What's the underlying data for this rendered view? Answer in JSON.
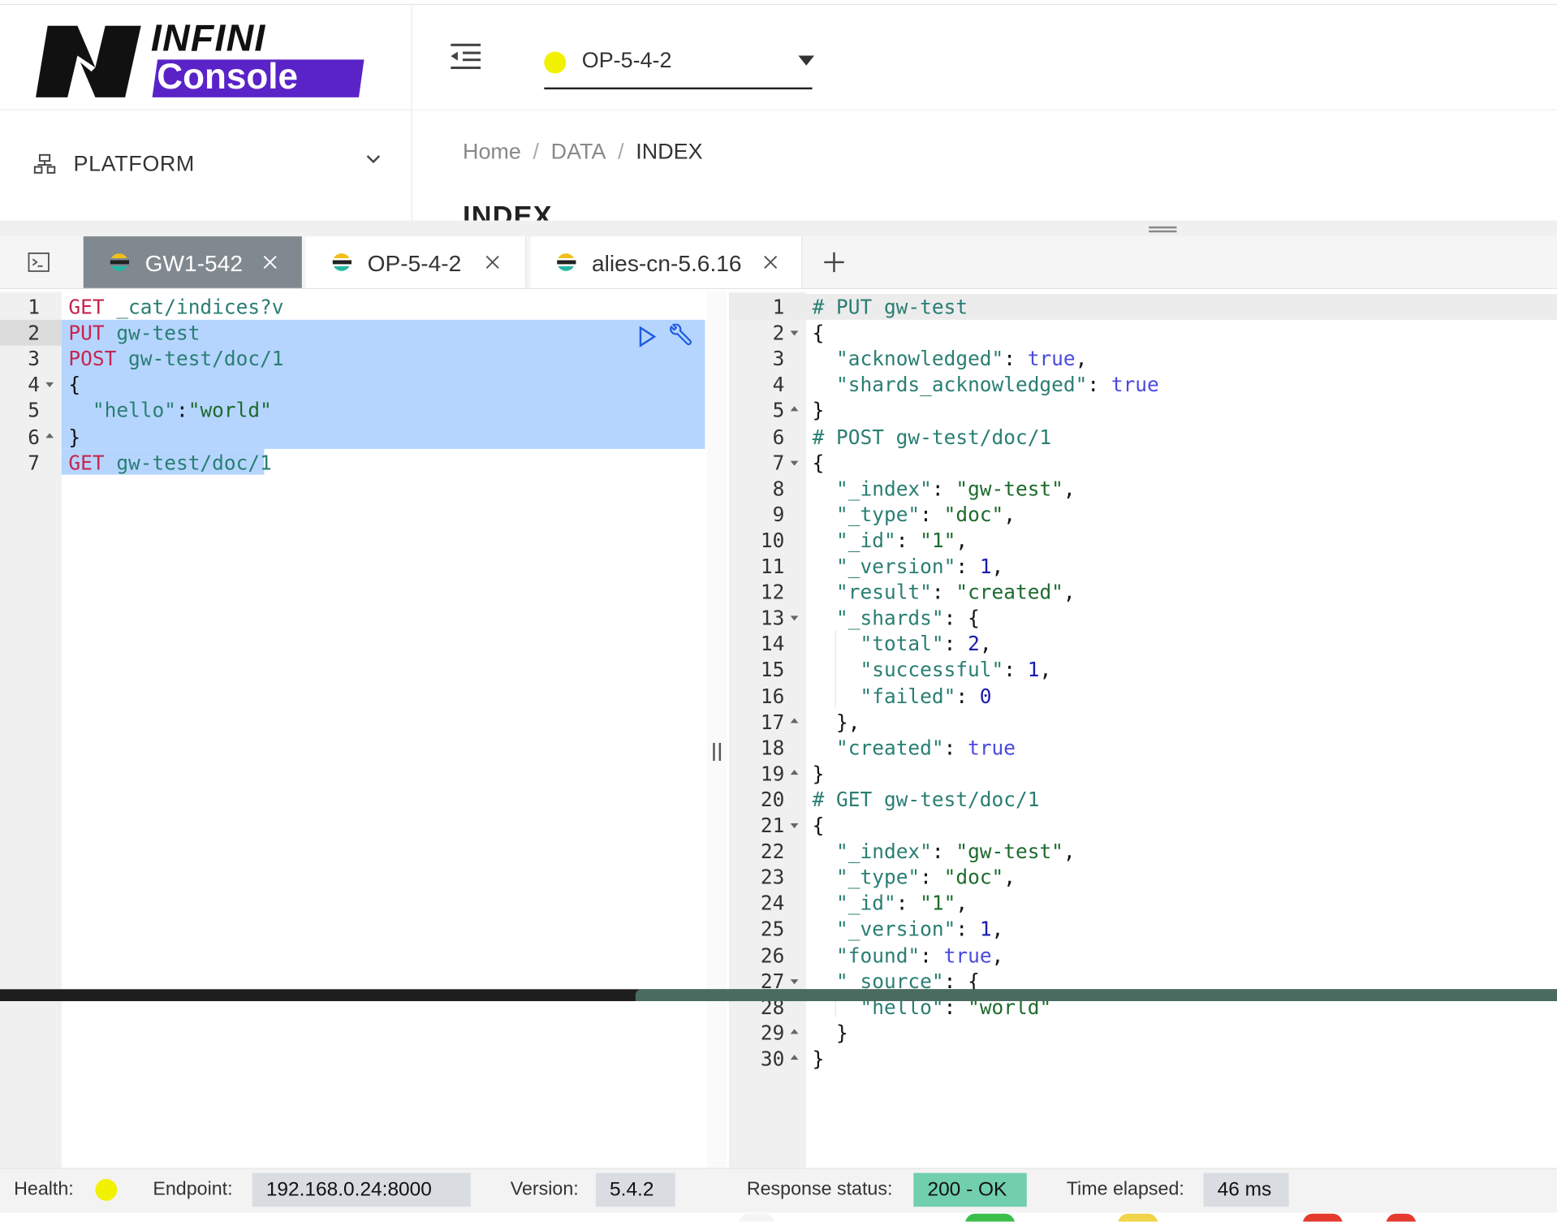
{
  "brand": {
    "line1": "INFINI",
    "line2": "Console",
    "slashes": "///"
  },
  "header": {
    "cluster": "OP-5-4-2",
    "cluster_status_color": "#f2f200"
  },
  "sidebar": {
    "platform_label": "PLATFORM"
  },
  "breadcrumb": {
    "items": [
      "Home",
      "DATA",
      "INDEX"
    ],
    "separator": "/"
  },
  "page": {
    "heading": "INDEX"
  },
  "tabs": [
    {
      "label": "GW1-542",
      "active": true
    },
    {
      "label": "OP-5-4-2",
      "active": false
    },
    {
      "label": "alies-cn-5.6.16",
      "active": false
    }
  ],
  "request_lines": [
    {
      "n": "1",
      "fold": "",
      "parts": [
        [
          "GET",
          "k-method"
        ],
        [
          " _cat/indices?v",
          "k-path"
        ]
      ]
    },
    {
      "n": "2",
      "fold": "",
      "parts": [
        [
          "PUT",
          "k-method"
        ],
        [
          " gw-test",
          "k-path"
        ]
      ]
    },
    {
      "n": "3",
      "fold": "",
      "parts": [
        [
          "POST",
          "k-method"
        ],
        [
          " gw-test/doc/1",
          "k-path"
        ]
      ]
    },
    {
      "n": "4",
      "fold": "open",
      "parts": [
        [
          "{",
          "k-punc"
        ]
      ]
    },
    {
      "n": "5",
      "fold": "",
      "parts": [
        [
          "  ",
          "k-punc"
        ],
        [
          "\"hello\"",
          "k-key"
        ],
        [
          ":",
          "k-punc"
        ],
        [
          "\"world\"",
          "k-str"
        ]
      ]
    },
    {
      "n": "6",
      "fold": "close",
      "parts": [
        [
          "}",
          "k-punc"
        ]
      ]
    },
    {
      "n": "7",
      "fold": "",
      "parts": [
        [
          "GET",
          "k-method"
        ],
        [
          " gw-test/doc/1",
          "k-path"
        ]
      ]
    }
  ],
  "response_lines": [
    {
      "n": "1",
      "fold": "",
      "parts": [
        [
          "# PUT gw-test",
          "k-comment"
        ]
      ]
    },
    {
      "n": "2",
      "fold": "open",
      "parts": [
        [
          "{",
          "k-punc"
        ]
      ]
    },
    {
      "n": "3",
      "fold": "",
      "parts": [
        [
          "  ",
          "k-punc"
        ],
        [
          "\"acknowledged\"",
          "k-key"
        ],
        [
          ": ",
          "k-punc"
        ],
        [
          "true",
          "k-bool"
        ],
        [
          ",",
          "k-punc"
        ]
      ]
    },
    {
      "n": "4",
      "fold": "",
      "parts": [
        [
          "  ",
          "k-punc"
        ],
        [
          "\"shards_acknowledged\"",
          "k-key"
        ],
        [
          ": ",
          "k-punc"
        ],
        [
          "true",
          "k-bool"
        ]
      ]
    },
    {
      "n": "5",
      "fold": "close",
      "parts": [
        [
          "}",
          "k-punc"
        ]
      ]
    },
    {
      "n": "6",
      "fold": "",
      "parts": [
        [
          "# POST gw-test/doc/1",
          "k-comment"
        ]
      ]
    },
    {
      "n": "7",
      "fold": "open",
      "parts": [
        [
          "{",
          "k-punc"
        ]
      ]
    },
    {
      "n": "8",
      "fold": "",
      "parts": [
        [
          "  ",
          "k-punc"
        ],
        [
          "\"_index\"",
          "k-key"
        ],
        [
          ": ",
          "k-punc"
        ],
        [
          "\"gw-test\"",
          "k-str"
        ],
        [
          ",",
          "k-punc"
        ]
      ]
    },
    {
      "n": "9",
      "fold": "",
      "parts": [
        [
          "  ",
          "k-punc"
        ],
        [
          "\"_type\"",
          "k-key"
        ],
        [
          ": ",
          "k-punc"
        ],
        [
          "\"doc\"",
          "k-str"
        ],
        [
          ",",
          "k-punc"
        ]
      ]
    },
    {
      "n": "10",
      "fold": "",
      "parts": [
        [
          "  ",
          "k-punc"
        ],
        [
          "\"_id\"",
          "k-key"
        ],
        [
          ": ",
          "k-punc"
        ],
        [
          "\"1\"",
          "k-str"
        ],
        [
          ",",
          "k-punc"
        ]
      ]
    },
    {
      "n": "11",
      "fold": "",
      "parts": [
        [
          "  ",
          "k-punc"
        ],
        [
          "\"_version\"",
          "k-key"
        ],
        [
          ": ",
          "k-punc"
        ],
        [
          "1",
          "k-num"
        ],
        [
          ",",
          "k-punc"
        ]
      ]
    },
    {
      "n": "12",
      "fold": "",
      "parts": [
        [
          "  ",
          "k-punc"
        ],
        [
          "\"result\"",
          "k-key"
        ],
        [
          ": ",
          "k-punc"
        ],
        [
          "\"created\"",
          "k-str"
        ],
        [
          ",",
          "k-punc"
        ]
      ]
    },
    {
      "n": "13",
      "fold": "open",
      "parts": [
        [
          "  ",
          "k-punc"
        ],
        [
          "\"_shards\"",
          "k-key"
        ],
        [
          ": {",
          "k-punc"
        ]
      ]
    },
    {
      "n": "14",
      "fold": "",
      "parts": [
        [
          "    ",
          "k-punc"
        ],
        [
          "\"total\"",
          "k-key"
        ],
        [
          ": ",
          "k-punc"
        ],
        [
          "2",
          "k-num"
        ],
        [
          ",",
          "k-punc"
        ]
      ]
    },
    {
      "n": "15",
      "fold": "",
      "parts": [
        [
          "    ",
          "k-punc"
        ],
        [
          "\"successful\"",
          "k-key"
        ],
        [
          ": ",
          "k-punc"
        ],
        [
          "1",
          "k-num"
        ],
        [
          ",",
          "k-punc"
        ]
      ]
    },
    {
      "n": "16",
      "fold": "",
      "parts": [
        [
          "    ",
          "k-punc"
        ],
        [
          "\"failed\"",
          "k-key"
        ],
        [
          ": ",
          "k-punc"
        ],
        [
          "0",
          "k-num"
        ]
      ]
    },
    {
      "n": "17",
      "fold": "close",
      "parts": [
        [
          "  },",
          "k-punc"
        ]
      ]
    },
    {
      "n": "18",
      "fold": "",
      "parts": [
        [
          "  ",
          "k-punc"
        ],
        [
          "\"created\"",
          "k-key"
        ],
        [
          ": ",
          "k-punc"
        ],
        [
          "true",
          "k-bool"
        ]
      ]
    },
    {
      "n": "19",
      "fold": "close",
      "parts": [
        [
          "}",
          "k-punc"
        ]
      ]
    },
    {
      "n": "20",
      "fold": "",
      "parts": [
        [
          "# GET gw-test/doc/1",
          "k-comment"
        ]
      ]
    },
    {
      "n": "21",
      "fold": "open",
      "parts": [
        [
          "{",
          "k-punc"
        ]
      ]
    },
    {
      "n": "22",
      "fold": "",
      "parts": [
        [
          "  ",
          "k-punc"
        ],
        [
          "\"_index\"",
          "k-key"
        ],
        [
          ": ",
          "k-punc"
        ],
        [
          "\"gw-test\"",
          "k-str"
        ],
        [
          ",",
          "k-punc"
        ]
      ]
    },
    {
      "n": "23",
      "fold": "",
      "parts": [
        [
          "  ",
          "k-punc"
        ],
        [
          "\"_type\"",
          "k-key"
        ],
        [
          ": ",
          "k-punc"
        ],
        [
          "\"doc\"",
          "k-str"
        ],
        [
          ",",
          "k-punc"
        ]
      ]
    },
    {
      "n": "24",
      "fold": "",
      "parts": [
        [
          "  ",
          "k-punc"
        ],
        [
          "\"_id\"",
          "k-key"
        ],
        [
          ": ",
          "k-punc"
        ],
        [
          "\"1\"",
          "k-str"
        ],
        [
          ",",
          "k-punc"
        ]
      ]
    },
    {
      "n": "25",
      "fold": "",
      "parts": [
        [
          "  ",
          "k-punc"
        ],
        [
          "\"_version\"",
          "k-key"
        ],
        [
          ": ",
          "k-punc"
        ],
        [
          "1",
          "k-num"
        ],
        [
          ",",
          "k-punc"
        ]
      ]
    },
    {
      "n": "26",
      "fold": "",
      "parts": [
        [
          "  ",
          "k-punc"
        ],
        [
          "\"found\"",
          "k-key"
        ],
        [
          ": ",
          "k-punc"
        ],
        [
          "true",
          "k-bool"
        ],
        [
          ",",
          "k-punc"
        ]
      ]
    },
    {
      "n": "27",
      "fold": "open",
      "parts": [
        [
          "  ",
          "k-punc"
        ],
        [
          "\"_source\"",
          "k-key"
        ],
        [
          ": {",
          "k-punc"
        ]
      ]
    },
    {
      "n": "28",
      "fold": "",
      "parts": [
        [
          "    ",
          "k-punc"
        ],
        [
          "\"hello\"",
          "k-key"
        ],
        [
          ": ",
          "k-punc"
        ],
        [
          "\"world\"",
          "k-str"
        ]
      ]
    },
    {
      "n": "29",
      "fold": "close",
      "parts": [
        [
          "  }",
          "k-punc"
        ]
      ]
    },
    {
      "n": "30",
      "fold": "close",
      "parts": [
        [
          "}",
          "k-punc"
        ]
      ]
    }
  ],
  "status": {
    "health_label": "Health:",
    "health_color": "#f2f200",
    "endpoint_label": "Endpoint:",
    "endpoint": "192.168.0.24:8000",
    "version_label": "Version:",
    "version": "5.4.2",
    "response_label": "Response status:",
    "response_status": "200 - OK",
    "elapsed_label": "Time elapsed:",
    "elapsed": "46 ms"
  }
}
